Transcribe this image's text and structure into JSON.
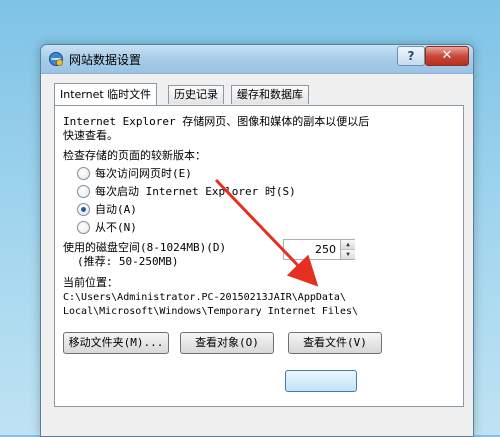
{
  "window": {
    "title": "网站数据设置",
    "help_label": "?",
    "close_label": "✕"
  },
  "tabs": [
    {
      "label": "Internet 临时文件"
    },
    {
      "label": "历史记录"
    },
    {
      "label": "缓存和数据库"
    }
  ],
  "panel": {
    "description_line1": "Internet Explorer 存储网页、图像和媒体的副本以便以后",
    "description_line2": "快速查看。",
    "check_label": "检查存储的页面的较新版本：",
    "radio_options": [
      {
        "label": "每次访问网页时(E)",
        "checked": false
      },
      {
        "label": "每次启动 Internet Explorer 时(S)",
        "checked": false
      },
      {
        "label": "自动(A)",
        "checked": true
      },
      {
        "label": "从不(N)",
        "checked": false
      }
    ],
    "disk_space_label": "使用的磁盘空间(8-1024MB)(D)",
    "disk_space_hint": "(推荐: 50-250MB)",
    "disk_space_value": "250",
    "location_label": "当前位置：",
    "location_path_line1": "C:\\Users\\Administrator.PC-20150213JAIR\\AppData\\",
    "location_path_line2": "Local\\Microsoft\\Windows\\Temporary Internet Files\\",
    "buttons": {
      "move_folder": "移动文件夹(M)...",
      "view_objects": "查看对象(O)",
      "view_files": "查看文件(V)"
    }
  },
  "colors": {
    "arrow": "#e53021",
    "title_bar": "#a7cce9",
    "radio_checked": "#1e5fa8"
  },
  "icons": {
    "title_icon": "internet-explorer-settings-icon",
    "arrow": "red-annotation-arrow"
  }
}
